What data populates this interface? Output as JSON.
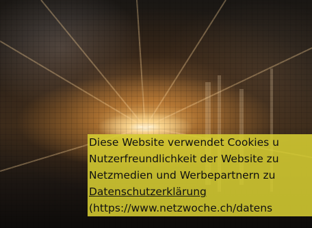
{
  "cookie_banner": {
    "line1": "Diese Website verwendet Cookies u",
    "line2": "Nutzerfreundlichkeit der Website zu",
    "line3": "Netzmedien und Werbepartnern zu",
    "privacy_link": "Datenschutzerklärung",
    "privacy_url": "(https://www.netzwoche.ch/datens"
  },
  "colors": {
    "banner_background": "#d6cd32",
    "banner_text": "#101010",
    "glow": "#ffdc96"
  }
}
